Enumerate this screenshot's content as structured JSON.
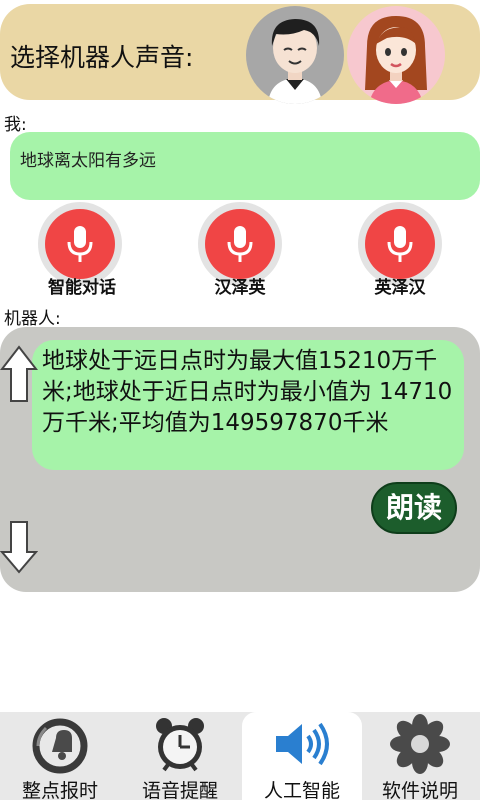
{
  "voice_select": {
    "title": "选择机器人声音:",
    "options": [
      {
        "icon": "male-avatar-icon"
      },
      {
        "icon": "female-avatar-icon"
      }
    ]
  },
  "me": {
    "label": "我:",
    "question": "地球离太阳有多远"
  },
  "modes": [
    {
      "label": "智能对话",
      "icon": "microphone-icon"
    },
    {
      "label": "汉泽英",
      "icon": "microphone-icon"
    },
    {
      "label": "英泽汉",
      "icon": "microphone-icon"
    }
  ],
  "robot": {
    "label": "机器人:",
    "answer": "地球处于远日点时为最大值15210万千米;地球处于近日点时为最小值为 14710万千米;平均值为149597870千米",
    "read_button": "朗读"
  },
  "tabs": [
    {
      "label": "整点报时",
      "icon": "clock-bell-icon",
      "active": false
    },
    {
      "label": "语音提醒",
      "icon": "alarm-clock-icon",
      "active": false
    },
    {
      "label": "人工智能",
      "icon": "speaker-icon",
      "active": true
    },
    {
      "label": "软件说明",
      "icon": "flower-info-icon",
      "active": false
    }
  ],
  "colors": {
    "voice_bar": "#ead7a5",
    "bubble": "#a6f3a9",
    "mic": "#f04545",
    "panel": "#c8c8c4",
    "read_button": "#1c5d2c",
    "tab_active_icon": "#2a7fd0"
  }
}
